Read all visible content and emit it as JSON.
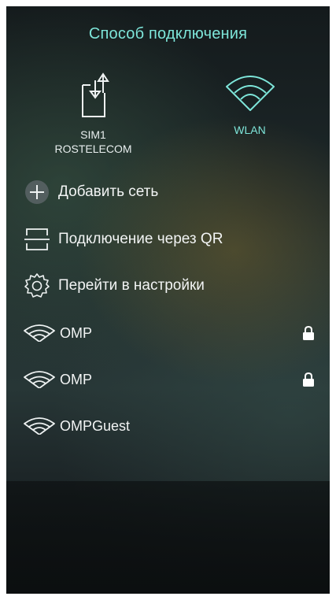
{
  "header": {
    "title": "Способ подключения"
  },
  "connections": [
    {
      "label_line1": "SIM1",
      "label_line2": "ROSTELECOM",
      "icon": "sim-data-icon",
      "selected": false
    },
    {
      "label": "WLAN",
      "icon": "wifi-icon",
      "selected": true
    }
  ],
  "actions": [
    {
      "label": "Добавить сеть",
      "icon": "add-icon"
    },
    {
      "label": "Подключение через QR",
      "icon": "qr-scan-icon"
    },
    {
      "label": "Перейти в настройки",
      "icon": "gear-icon"
    }
  ],
  "networks": [
    {
      "ssid": "OMP",
      "secured": true
    },
    {
      "ssid": "OMP",
      "secured": true
    },
    {
      "ssid": "OMPGuest",
      "secured": false
    }
  ],
  "colors": {
    "accent": "#7ee6da",
    "text": "#f2f4f4"
  }
}
